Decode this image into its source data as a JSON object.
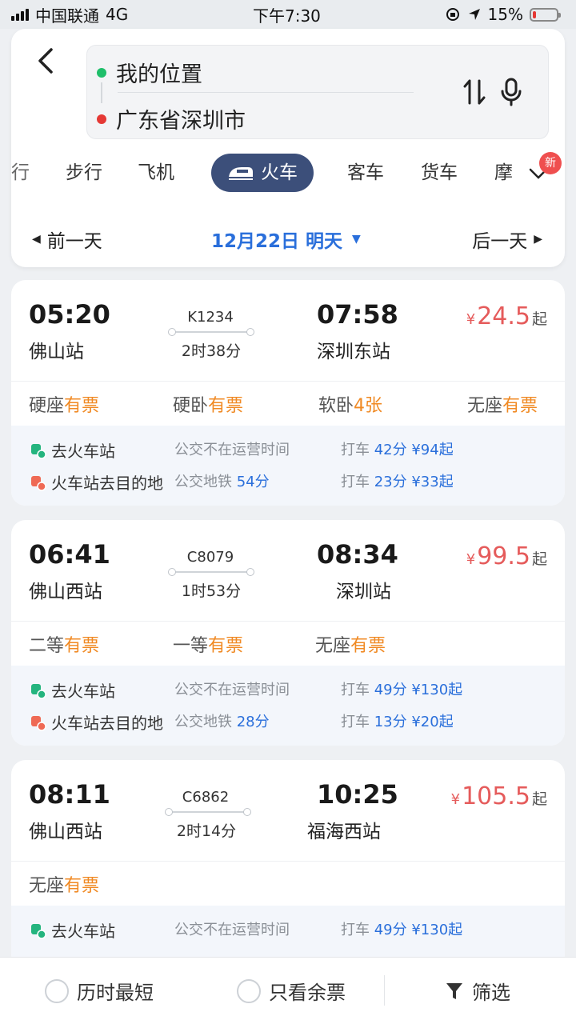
{
  "status_bar": {
    "carrier": "中国联通",
    "network": "4G",
    "time": "下午7:30",
    "battery": "15%",
    "battery_level": 0.15
  },
  "route": {
    "from": "我的位置",
    "to": "广东省深圳市"
  },
  "modes": [
    "行",
    "步行",
    "飞机",
    "火车",
    "客车",
    "货车",
    "摩"
  ],
  "active_mode": "火车",
  "new_badge": "新",
  "date_bar": {
    "prev": "前一天",
    "current": "12月22日 明天",
    "next": "后一天"
  },
  "trains": [
    {
      "dep_time": "05:20",
      "dep_station": "佛山站",
      "train_no": "K1234",
      "duration": "2时38分",
      "arr_time": "07:58",
      "arr_station": "深圳东站",
      "price_yen": "¥",
      "price": "24.5",
      "price_suffix": "起",
      "seats": [
        {
          "type": "硬座",
          "avail": "有票"
        },
        {
          "type": "硬卧",
          "avail": "有票"
        },
        {
          "type": "软卧",
          "avail": "4张"
        },
        {
          "type": "无座",
          "avail": "有票"
        }
      ],
      "to_station_label": "去火车站",
      "to_station_bus": "公交不在运营时间",
      "to_station_taxi_label": "打车",
      "to_station_taxi": "42分 ¥94起",
      "from_station_label": "火车站去目的地",
      "from_station_bus_label": "公交地铁",
      "from_station_bus": "54分",
      "from_station_taxi_label": "打车",
      "from_station_taxi": "23分 ¥33起"
    },
    {
      "dep_time": "06:41",
      "dep_station": "佛山西站",
      "train_no": "C8079",
      "duration": "1时53分",
      "arr_time": "08:34",
      "arr_station": "深圳站",
      "price_yen": "¥",
      "price": "99.5",
      "price_suffix": "起",
      "seats": [
        {
          "type": "二等",
          "avail": "有票"
        },
        {
          "type": "一等",
          "avail": "有票"
        },
        {
          "type": "无座",
          "avail": "有票"
        }
      ],
      "to_station_label": "去火车站",
      "to_station_bus": "公交不在运营时间",
      "to_station_taxi_label": "打车",
      "to_station_taxi": "49分 ¥130起",
      "from_station_label": "火车站去目的地",
      "from_station_bus_label": "公交地铁",
      "from_station_bus": "28分",
      "from_station_taxi_label": "打车",
      "from_station_taxi": "13分 ¥20起"
    },
    {
      "dep_time": "08:11",
      "dep_station": "佛山西站",
      "train_no": "C6862",
      "duration": "2时14分",
      "arr_time": "10:25",
      "arr_station": "福海西站",
      "price_yen": "¥",
      "price": "105.5",
      "price_suffix": "起",
      "seats": [
        {
          "type": "无座",
          "avail": "有票"
        }
      ],
      "to_station_label": "去火车站",
      "to_station_bus": "公交不在运营时间",
      "to_station_taxi_label": "打车",
      "to_station_taxi": "49分 ¥130起"
    }
  ],
  "bottom_bar": {
    "shortest": "历时最短",
    "only_available": "只看余票",
    "filter": "筛选"
  },
  "colors": {
    "accent_blue": "#2a6fdb",
    "active_tab_bg": "#3c4f7a",
    "price_red": "#e55b5b",
    "available_orange": "#f08a24",
    "from_dot": "#1fbf6a",
    "to_dot": "#e53935"
  }
}
